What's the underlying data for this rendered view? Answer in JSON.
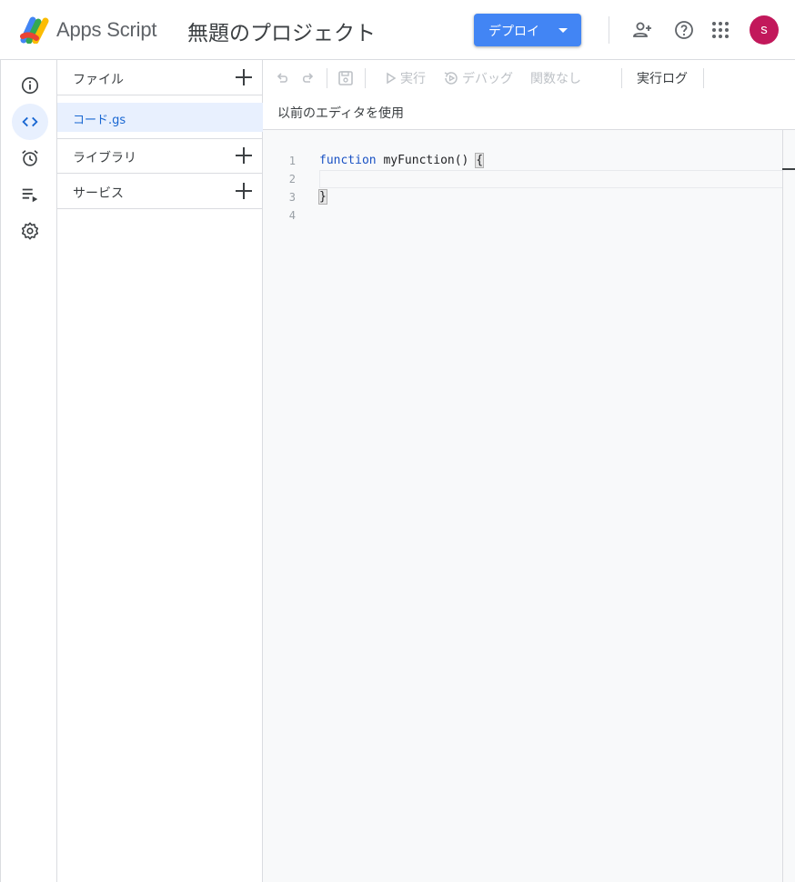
{
  "header": {
    "app_name": "Apps Script",
    "project_title": "無題のプロジェクト",
    "deploy_label": "デプロイ",
    "avatar_letter": "s"
  },
  "files_panel": {
    "files_section": "ファイル",
    "active_file": "コード.gs",
    "libraries_section": "ライブラリ",
    "services_section": "サービス"
  },
  "toolbar": {
    "run_label": "実行",
    "debug_label": "デバッグ",
    "function_select": "関数なし",
    "execution_log": "実行ログ",
    "legacy_editor": "以前のエディタを使用"
  },
  "editor": {
    "line_numbers": [
      "1",
      "2",
      "3",
      "4"
    ],
    "code": {
      "line1_keyword": "function",
      "line1_name": " myFunction() ",
      "line1_brace": "{",
      "line3_brace": "}"
    }
  },
  "colors": {
    "accent": "#4285f4",
    "avatar": "#c2185b",
    "active_bg": "#e8f0fe",
    "active_text": "#1967d2"
  }
}
